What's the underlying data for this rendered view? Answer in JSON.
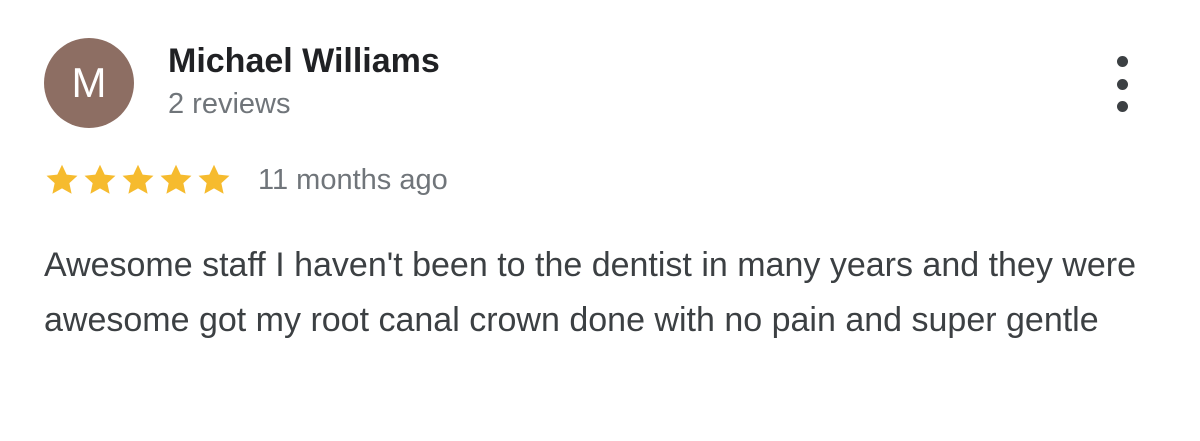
{
  "review": {
    "avatar_letter": "M",
    "author_name": "Michael Williams",
    "review_count": "2 reviews",
    "rating": 5,
    "rating_max": 5,
    "timestamp": "11 months ago",
    "text": "Awesome staff I haven't been to the dentist in many years and they were awesome got my root canal crown done with no pain and super gentle"
  },
  "colors": {
    "avatar_background": "#8d6e63",
    "star_filled": "#f6bb2e",
    "name_text": "#202124",
    "secondary_text": "#70757a",
    "body_text": "#3c4043"
  },
  "icons": {
    "more": "more-vert-icon",
    "star": "star-icon"
  }
}
